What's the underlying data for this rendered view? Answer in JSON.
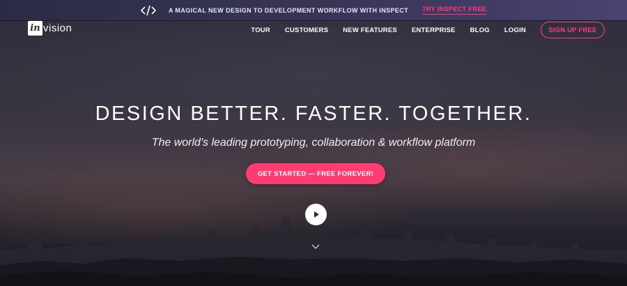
{
  "promo": {
    "icon": "code-icon",
    "text": "A MAGICAL NEW DESIGN TO DEVELOPMENT WORKFLOW WITH INSPECT",
    "cta": "TRY INSPECT FREE"
  },
  "logo": {
    "badge": "in",
    "word": "vision"
  },
  "nav": {
    "items": [
      "TOUR",
      "CUSTOMERS",
      "NEW FEATURES",
      "ENTERPRISE",
      "BLOG",
      "LOGIN"
    ],
    "signup": "SIGN UP FREE"
  },
  "hero": {
    "headline": "DESIGN BETTER. FASTER. TOGETHER.",
    "subhead": "The world's leading prototyping, collaboration & workflow platform",
    "cta": "GET STARTED — FREE FOREVER!",
    "play_icon": "play-icon",
    "scroll_icon": "chevron-down-icon"
  },
  "colors": {
    "accent": "#ff3d70",
    "promo_bg": "#2a2c45",
    "hero_bg": "#363443"
  }
}
